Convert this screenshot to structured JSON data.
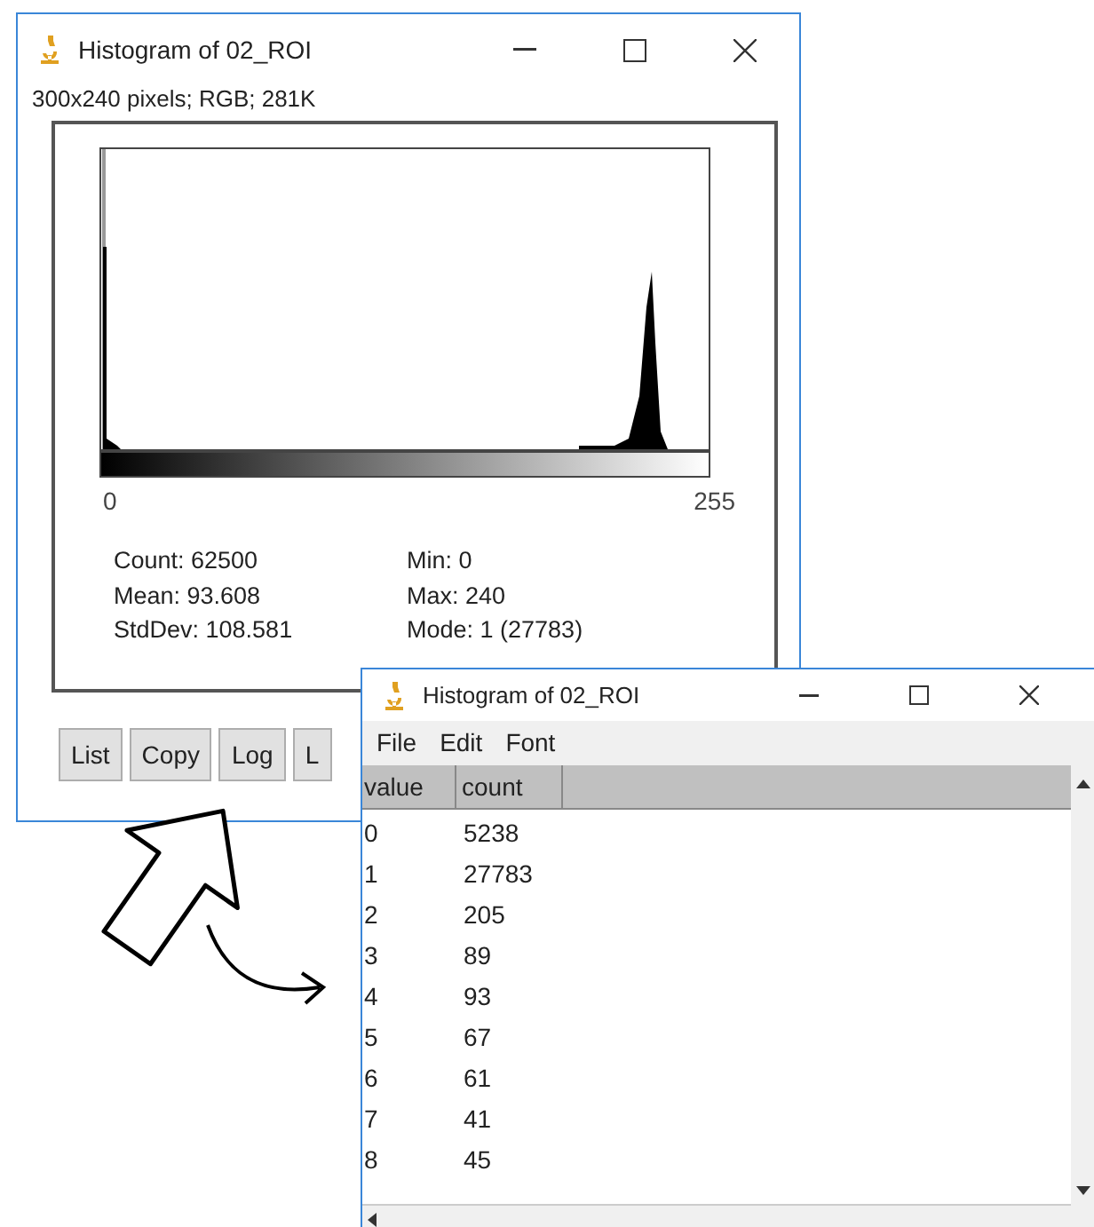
{
  "histogram_window": {
    "title": "Histogram of 02_ROI",
    "info": "300x240 pixels; RGB; 281K",
    "x_axis_labels": [
      "0",
      "255"
    ],
    "stats_left": [
      "Count: 62500",
      "Mean: 93.608",
      "StdDev: 108.581"
    ],
    "stats_right": [
      "Min: 0",
      "Max: 240",
      "Mode: 1 (27783)"
    ],
    "buttons": [
      "List",
      "Copy",
      "Log",
      "L"
    ]
  },
  "list_window": {
    "title": "Histogram of 02_ROI",
    "menu": [
      "File",
      "Edit",
      "Font"
    ],
    "columns": [
      "value",
      "count"
    ],
    "rows": [
      [
        "0",
        "5238"
      ],
      [
        "1",
        "27783"
      ],
      [
        "2",
        "205"
      ],
      [
        "3",
        "89"
      ],
      [
        "4",
        "93"
      ],
      [
        "5",
        "67"
      ],
      [
        "6",
        "61"
      ],
      [
        "7",
        "41"
      ],
      [
        "8",
        "45"
      ]
    ]
  }
}
